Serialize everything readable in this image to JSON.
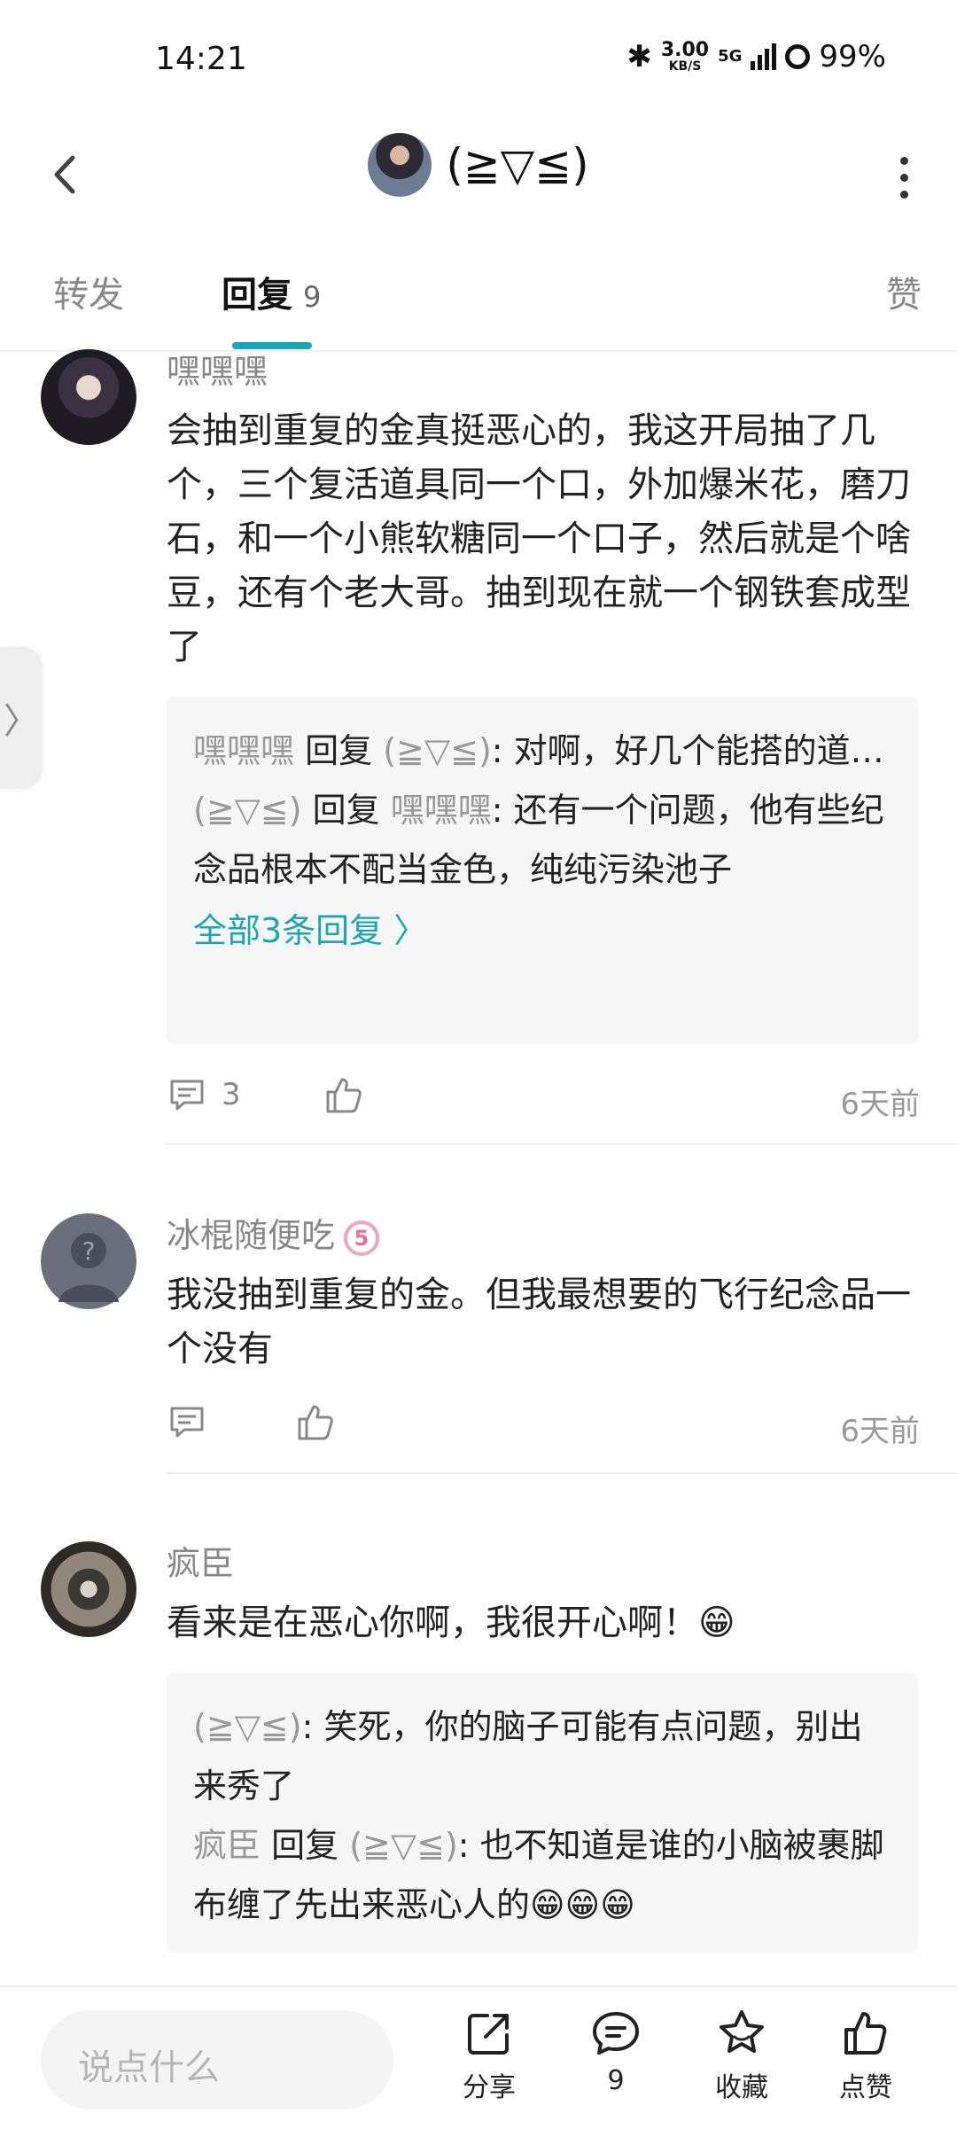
{
  "status": {
    "time": "14:21",
    "speed_value": "3.00",
    "speed_unit": "KB/S",
    "network": "5G",
    "battery": "99%"
  },
  "header": {
    "title": "(≧▽≦)"
  },
  "tabs": {
    "forward": "转发",
    "reply": "回复",
    "reply_count": "9",
    "like": "赞"
  },
  "side_handle": "〉",
  "comments": [
    {
      "user": "嘿嘿嘿",
      "text": "会抽到重复的金真挺恶心的，我这开局抽了几个，三个复活道具同一个口，外加爆米花，磨刀石，和一个小熊软糖同一个口子，然后就是个啥豆，还有个老大哥。抽到现在就一个钢铁套成型了",
      "replies": [
        {
          "from": "嘿嘿嘿",
          "verb": "回复",
          "to": "(≧▽≦)",
          "text": ": 对啊，好几个能搭的道具因为在一个格子里没办法一起用，就只能选一个用"
        },
        {
          "from": "(≧▽≦)",
          "verb": "回复",
          "to": "嘿嘿嘿",
          "text": ": 还有一个问题，他有些纪念品根本不配当金色，纯纯污染池子"
        }
      ],
      "view_all": "全部3条回复 〉",
      "comment_count": "3",
      "time": "6天前"
    },
    {
      "user": "冰棍随便吃",
      "badge": "5",
      "text": "我没抽到重复的金。但我最想要的飞行纪念品一个没有",
      "time": "6天前"
    },
    {
      "user": "疯臣",
      "text": "看来是在恶心你啊，我很开心啊！😁",
      "replies": [
        {
          "from": "(≧▽≦)",
          "text": ": 笑死，你的脑子可能有点问题，别出来秀了"
        },
        {
          "from": "疯臣",
          "verb": "回复",
          "to": "(≧▽≦)",
          "text": ": 也不知道是谁的小脑被裹脚布缠了先出来恶心人的😁😁😁"
        }
      ]
    }
  ],
  "bottom": {
    "input_placeholder": "说点什么",
    "share": "分享",
    "comments_count": "9",
    "favorite": "收藏",
    "like": "点赞"
  },
  "colors": {
    "accent": "#19a7b5",
    "username": "#888888",
    "reply_bg": "#f6f6f6"
  }
}
